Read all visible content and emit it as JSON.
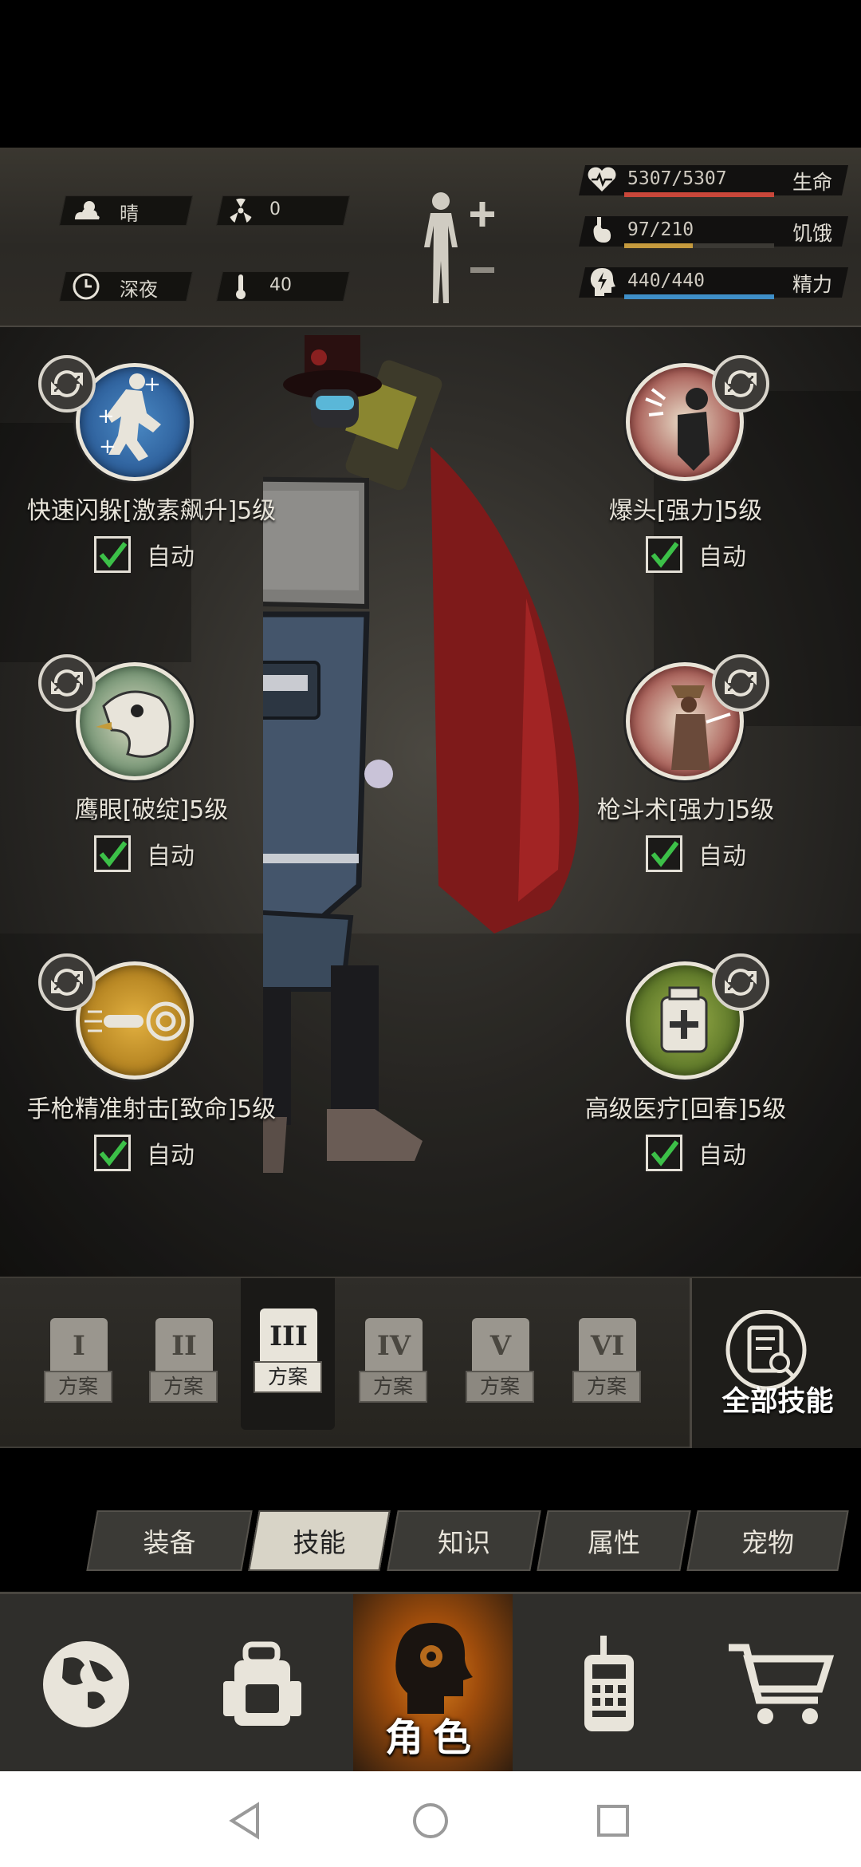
{
  "status": {
    "weather": "晴",
    "radiation": "0",
    "time_of_day": "深夜",
    "temperature": "40",
    "health": {
      "value": "5307/5307",
      "label": "生命",
      "fill": 1.0,
      "color": "#c9473a"
    },
    "hunger": {
      "value": "97/210",
      "label": "饥饿",
      "fill": 0.46,
      "color": "#c59a3d"
    },
    "energy": {
      "value": "440/440",
      "label": "精力",
      "fill": 1.0,
      "color": "#3f8fc8"
    }
  },
  "skills": [
    {
      "name": "快速闪躲[激素飙升]5级",
      "auto_label": "自动",
      "checked": true,
      "icon": "dodge-icon"
    },
    {
      "name": "爆头[强力]5级",
      "auto_label": "自动",
      "checked": true,
      "icon": "headshot-icon"
    },
    {
      "name": "鹰眼[破绽]5级",
      "auto_label": "自动",
      "checked": true,
      "icon": "eagle-eye-icon"
    },
    {
      "name": "枪斗术[强力]5级",
      "auto_label": "自动",
      "checked": true,
      "icon": "gun-kata-icon"
    },
    {
      "name": "手枪精准射击[致命]5级",
      "auto_label": "自动",
      "checked": true,
      "icon": "pistol-precision-icon"
    },
    {
      "name": "高级医疗[回春]5级",
      "auto_label": "自动",
      "checked": true,
      "icon": "advanced-medical-icon"
    }
  ],
  "plans": [
    {
      "numeral": "I",
      "label": "方案",
      "selected": false
    },
    {
      "numeral": "II",
      "label": "方案",
      "selected": false
    },
    {
      "numeral": "III",
      "label": "方案",
      "selected": true
    },
    {
      "numeral": "IV",
      "label": "方案",
      "selected": false
    },
    {
      "numeral": "V",
      "label": "方案",
      "selected": false
    },
    {
      "numeral": "VI",
      "label": "方案",
      "selected": false
    }
  ],
  "all_skills_label": "全部技能",
  "tabs": [
    {
      "label": "装备",
      "active": false
    },
    {
      "label": "技能",
      "active": true
    },
    {
      "label": "知识",
      "active": false
    },
    {
      "label": "属性",
      "active": false
    },
    {
      "label": "宠物",
      "active": false
    }
  ],
  "nav": {
    "items": [
      "globe-icon",
      "backpack-icon",
      "character-icon",
      "radio-icon",
      "cart-icon"
    ],
    "active_label": "角色"
  }
}
